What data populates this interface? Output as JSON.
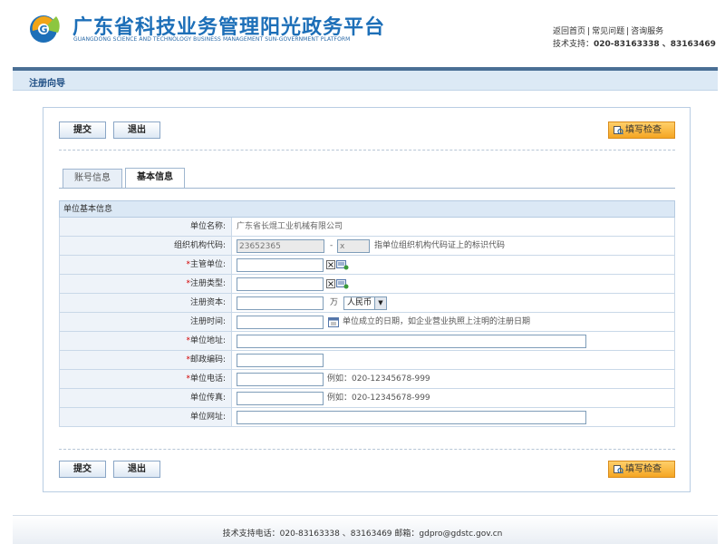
{
  "header": {
    "title": "广东省科技业务管理阳光政务平台",
    "subtitle": "GUANGDONG SCIENCE AND TECHNOLOGY BUSINESS MANAGEMENT SUN-GOVERNMENT PLATFORM",
    "links": [
      "返回首页",
      "常见问题",
      "咨询服务"
    ],
    "support_label": "技术支持：",
    "support_phones": "020-83163338 、83163469"
  },
  "page_title": "注册向导",
  "toolbar": {
    "submit_label": "提交",
    "exit_label": "退出",
    "check_label": "填写检查"
  },
  "tabs": [
    {
      "label": "账号信息",
      "active": false
    },
    {
      "label": "基本信息",
      "active": true
    }
  ],
  "section_title": "单位基本信息",
  "form": {
    "unit_name": {
      "label": "单位名称:",
      "value": "广东省长焜工业机械有限公司"
    },
    "org_code": {
      "label": "组织机构代码:",
      "value": "23652365",
      "dash": "-",
      "suffix": "x",
      "note": "指单位组织机构代码证上的标识代码"
    },
    "supervisor": {
      "label": "主管单位:",
      "required": "*",
      "value": ""
    },
    "reg_type": {
      "label": "注册类型:",
      "required": "*",
      "value": ""
    },
    "capital": {
      "label": "注册资本:",
      "value": "",
      "unit": "万",
      "currency": "人民币"
    },
    "reg_date": {
      "label": "注册时间:",
      "value": "",
      "note": "单位成立的日期，如企业营业执照上注明的注册日期"
    },
    "address": {
      "label": "单位地址:",
      "required": "*",
      "value": ""
    },
    "postcode": {
      "label": "邮政编码:",
      "required": "*",
      "value": ""
    },
    "phone": {
      "label": "单位电话:",
      "required": "*",
      "value": "",
      "note": "例如：020-12345678-999"
    },
    "fax": {
      "label": "单位传真:",
      "value": "",
      "note": "例如：020-12345678-999"
    },
    "website": {
      "label": "单位网址:",
      "value": ""
    }
  },
  "footer": {
    "text": "技术支持电话：020-83163338 、83163469  邮箱：gdpro@gdstc.gov.cn"
  },
  "colors": {
    "brand_blue": "#1d6fb8",
    "header_line": "#4a6f95",
    "orange_button": "#f5a623",
    "required": "#d40000"
  }
}
